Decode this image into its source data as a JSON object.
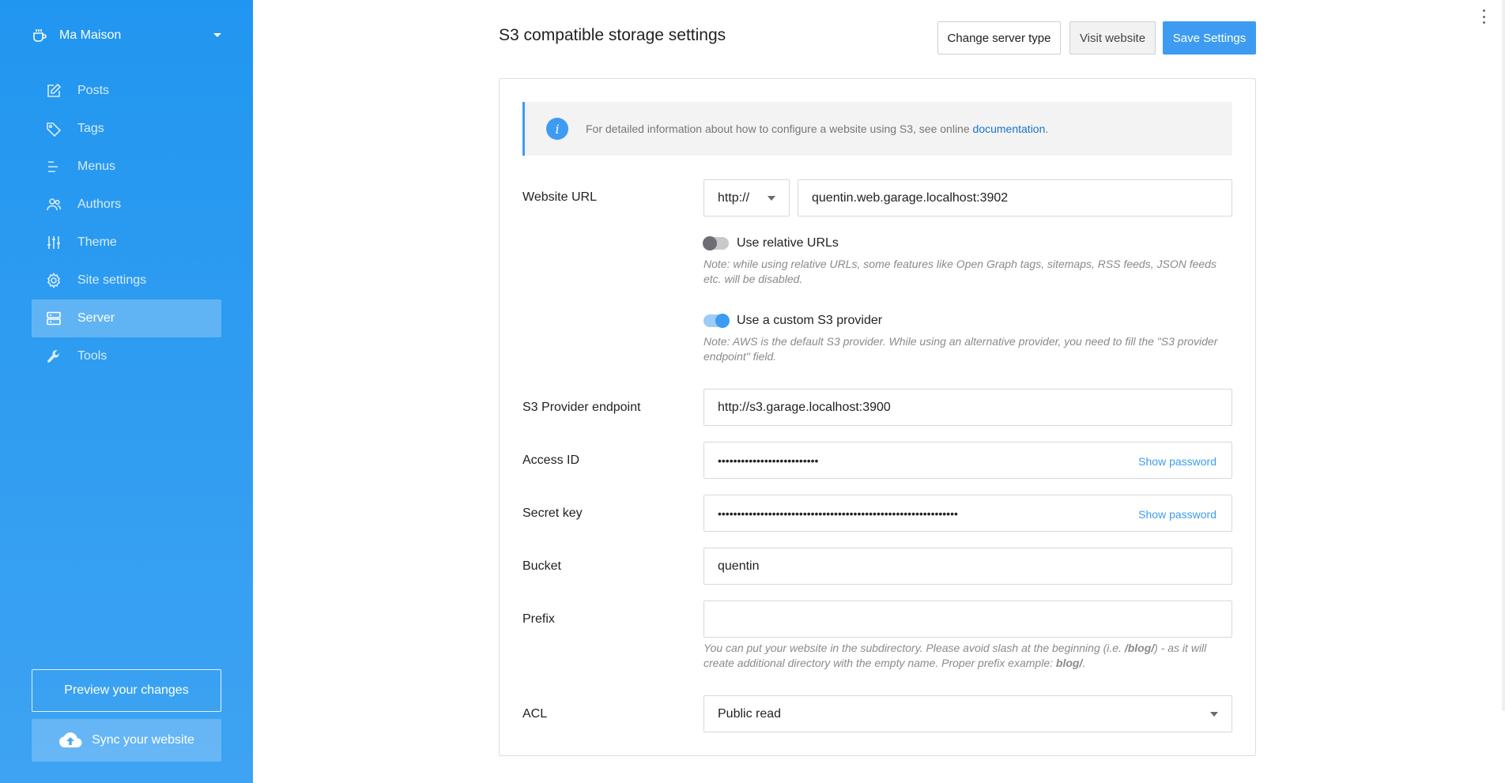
{
  "sidebar": {
    "site_name": "Ma Maison",
    "items": [
      {
        "label": "Posts",
        "icon": "edit-icon"
      },
      {
        "label": "Tags",
        "icon": "tag-icon"
      },
      {
        "label": "Menus",
        "icon": "menu-icon"
      },
      {
        "label": "Authors",
        "icon": "users-icon"
      },
      {
        "label": "Theme",
        "icon": "sliders-icon"
      },
      {
        "label": "Site settings",
        "icon": "gear-icon"
      },
      {
        "label": "Server",
        "icon": "server-icon",
        "active": true
      },
      {
        "label": "Tools",
        "icon": "wrench-icon"
      }
    ],
    "preview_label": "Preview your changes",
    "sync_label": "Sync your website"
  },
  "header": {
    "title": "S3 compatible storage settings",
    "change_server_label": "Change server type",
    "visit_label": "Visit website",
    "save_label": "Save Settings"
  },
  "info": {
    "text": "For detailed information about how to configure a website using S3, see online ",
    "link": "documentation",
    "end": "."
  },
  "form": {
    "website_url": {
      "label": "Website URL",
      "protocol": "http://",
      "value": "quentin.web.garage.localhost:3902"
    },
    "relative_urls": {
      "label": "Use relative URLs",
      "enabled": false,
      "note": "Note: while using relative URLs, some features like Open Graph tags, sitemaps, RSS feeds, JSON feeds etc. will be disabled."
    },
    "custom_provider": {
      "label": "Use a custom S3 provider",
      "enabled": true,
      "note": "Note: AWS is the default S3 provider. While using an alternative provider, you need to fill the \"S3 provider endpoint\" field."
    },
    "endpoint": {
      "label": "S3 Provider endpoint",
      "value": "http://s3.garage.localhost:3900"
    },
    "access_id": {
      "label": "Access ID",
      "value": "••••••••••••••••••••••••••",
      "show_label": "Show password"
    },
    "secret_key": {
      "label": "Secret key",
      "value": "••••••••••••••••••••••••••••••••••••••••••••••••••••••••••••••",
      "show_label": "Show password"
    },
    "bucket": {
      "label": "Bucket",
      "value": "quentin"
    },
    "prefix": {
      "label": "Prefix",
      "value": "",
      "note_a": "You can put your website in the subdirectory. Please avoid slash at the beginning (i.e. ",
      "note_b": "/blog/",
      "note_c": ") - as it will create additional directory with the empty name. Proper prefix example: ",
      "note_d": "blog/",
      "note_e": "."
    },
    "acl": {
      "label": "ACL",
      "value": "Public read"
    }
  },
  "colors": {
    "accent": "#3d9cf1",
    "sidebar_top": "#2196f0",
    "sidebar_bottom": "#3ea3f2"
  }
}
